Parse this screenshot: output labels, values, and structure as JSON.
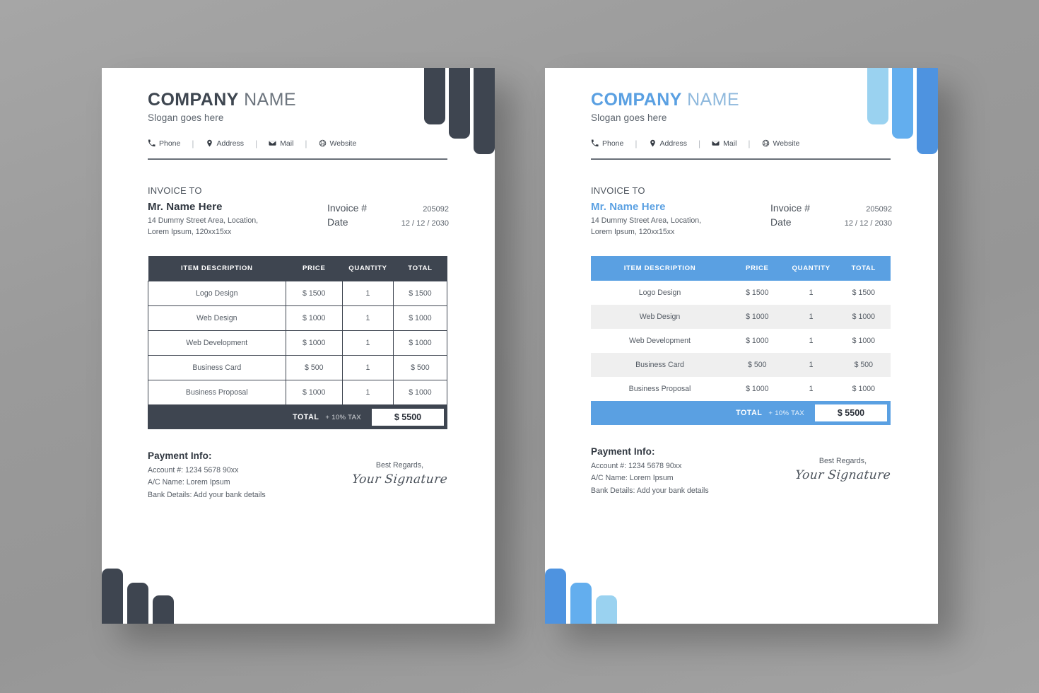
{
  "canvas": {
    "background_color": "#9a9a9a"
  },
  "invoices": [
    {
      "variant": "dark",
      "accent_color": "#3e4550",
      "brand": {
        "name_strong": "COMPANY",
        "name_light": "NAME",
        "slogan": "Slogan goes here"
      },
      "contact": [
        {
          "icon": "phone-icon",
          "label": "Phone"
        },
        {
          "icon": "location-pin-icon",
          "label": "Address"
        },
        {
          "icon": "mail-icon",
          "label": "Mail"
        },
        {
          "icon": "globe-icon",
          "label": "Website"
        }
      ],
      "separator": "|",
      "invoice_to": {
        "label": "INVOICE TO",
        "client_name": "Mr. Name Here",
        "address_line1": "14 Dummy Street Area, Location,",
        "address_line2": "Lorem Ipsum, 120xx15xx"
      },
      "details": [
        {
          "key": "Invoice #",
          "value": "205092"
        },
        {
          "key": "Date",
          "value": "12 / 12 / 2030"
        }
      ],
      "table": {
        "columns": [
          "ITEM DESCRIPTION",
          "PRICE",
          "QUANTITY",
          "TOTAL"
        ],
        "rows": [
          {
            "description": "Logo Design",
            "price": "$ 1500",
            "quantity": "1",
            "total": "$ 1500"
          },
          {
            "description": "Web Design",
            "price": "$ 1000",
            "quantity": "1",
            "total": "$ 1000"
          },
          {
            "description": "Web Development",
            "price": "$ 1000",
            "quantity": "1",
            "total": "$ 1000"
          },
          {
            "description": "Business Card",
            "price": "$ 500",
            "quantity": "1",
            "total": "$ 500"
          },
          {
            "description": "Business Proposal",
            "price": "$ 1000",
            "quantity": "1",
            "total": "$ 1000"
          }
        ],
        "total_label": "TOTAL",
        "tax_label": "+ 10% TAX",
        "grand_total": "$ 5500"
      },
      "payment": {
        "title": "Payment Info:",
        "account": "Account #: 1234 5678 90xx",
        "ac_name": "A/C Name: Lorem Ipsum",
        "bank": "Bank Details: Add your bank details"
      },
      "signature": {
        "regards": "Best Regards,",
        "name": "Your Signature"
      },
      "top_bars": [
        "#3e4550",
        "#3e4550",
        "#3e4550"
      ],
      "bottom_bars": [
        "#3e4550",
        "#3e4550",
        "#3e4550"
      ]
    },
    {
      "variant": "blue",
      "accent_color": "#5aa0e2",
      "brand": {
        "name_strong": "COMPANY",
        "name_light": "NAME",
        "slogan": "Slogan goes here"
      },
      "contact": [
        {
          "icon": "phone-icon",
          "label": "Phone"
        },
        {
          "icon": "location-pin-icon",
          "label": "Address"
        },
        {
          "icon": "mail-icon",
          "label": "Mail"
        },
        {
          "icon": "globe-icon",
          "label": "Website"
        }
      ],
      "separator": "|",
      "invoice_to": {
        "label": "INVOICE TO",
        "client_name": "Mr. Name Here",
        "address_line1": "14 Dummy Street Area, Location,",
        "address_line2": "Lorem Ipsum, 120xx15xx"
      },
      "details": [
        {
          "key": "Invoice #",
          "value": "205092"
        },
        {
          "key": "Date",
          "value": "12 / 12 / 2030"
        }
      ],
      "table": {
        "columns": [
          "ITEM DESCRIPTION",
          "PRICE",
          "QUANTITY",
          "TOTAL"
        ],
        "rows": [
          {
            "description": "Logo Design",
            "price": "$ 1500",
            "quantity": "1",
            "total": "$ 1500"
          },
          {
            "description": "Web Design",
            "price": "$ 1000",
            "quantity": "1",
            "total": "$ 1000"
          },
          {
            "description": "Web Development",
            "price": "$ 1000",
            "quantity": "1",
            "total": "$ 1000"
          },
          {
            "description": "Business Card",
            "price": "$ 500",
            "quantity": "1",
            "total": "$ 500"
          },
          {
            "description": "Business Proposal",
            "price": "$ 1000",
            "quantity": "1",
            "total": "$ 1000"
          }
        ],
        "total_label": "TOTAL",
        "tax_label": "+ 10% TAX",
        "grand_total": "$ 5500"
      },
      "payment": {
        "title": "Payment Info:",
        "account": "Account #: 1234 5678 90xx",
        "ac_name": "A/C Name: Lorem Ipsum",
        "bank": "Bank Details: Add your bank details"
      },
      "signature": {
        "regards": "Best Regards,",
        "name": "Your Signature"
      },
      "top_bars": [
        "#9ad2f0",
        "#63aeee",
        "#4e93e0"
      ],
      "bottom_bars": [
        "#4e93e0",
        "#63aeee",
        "#9ad2f0"
      ]
    }
  ]
}
